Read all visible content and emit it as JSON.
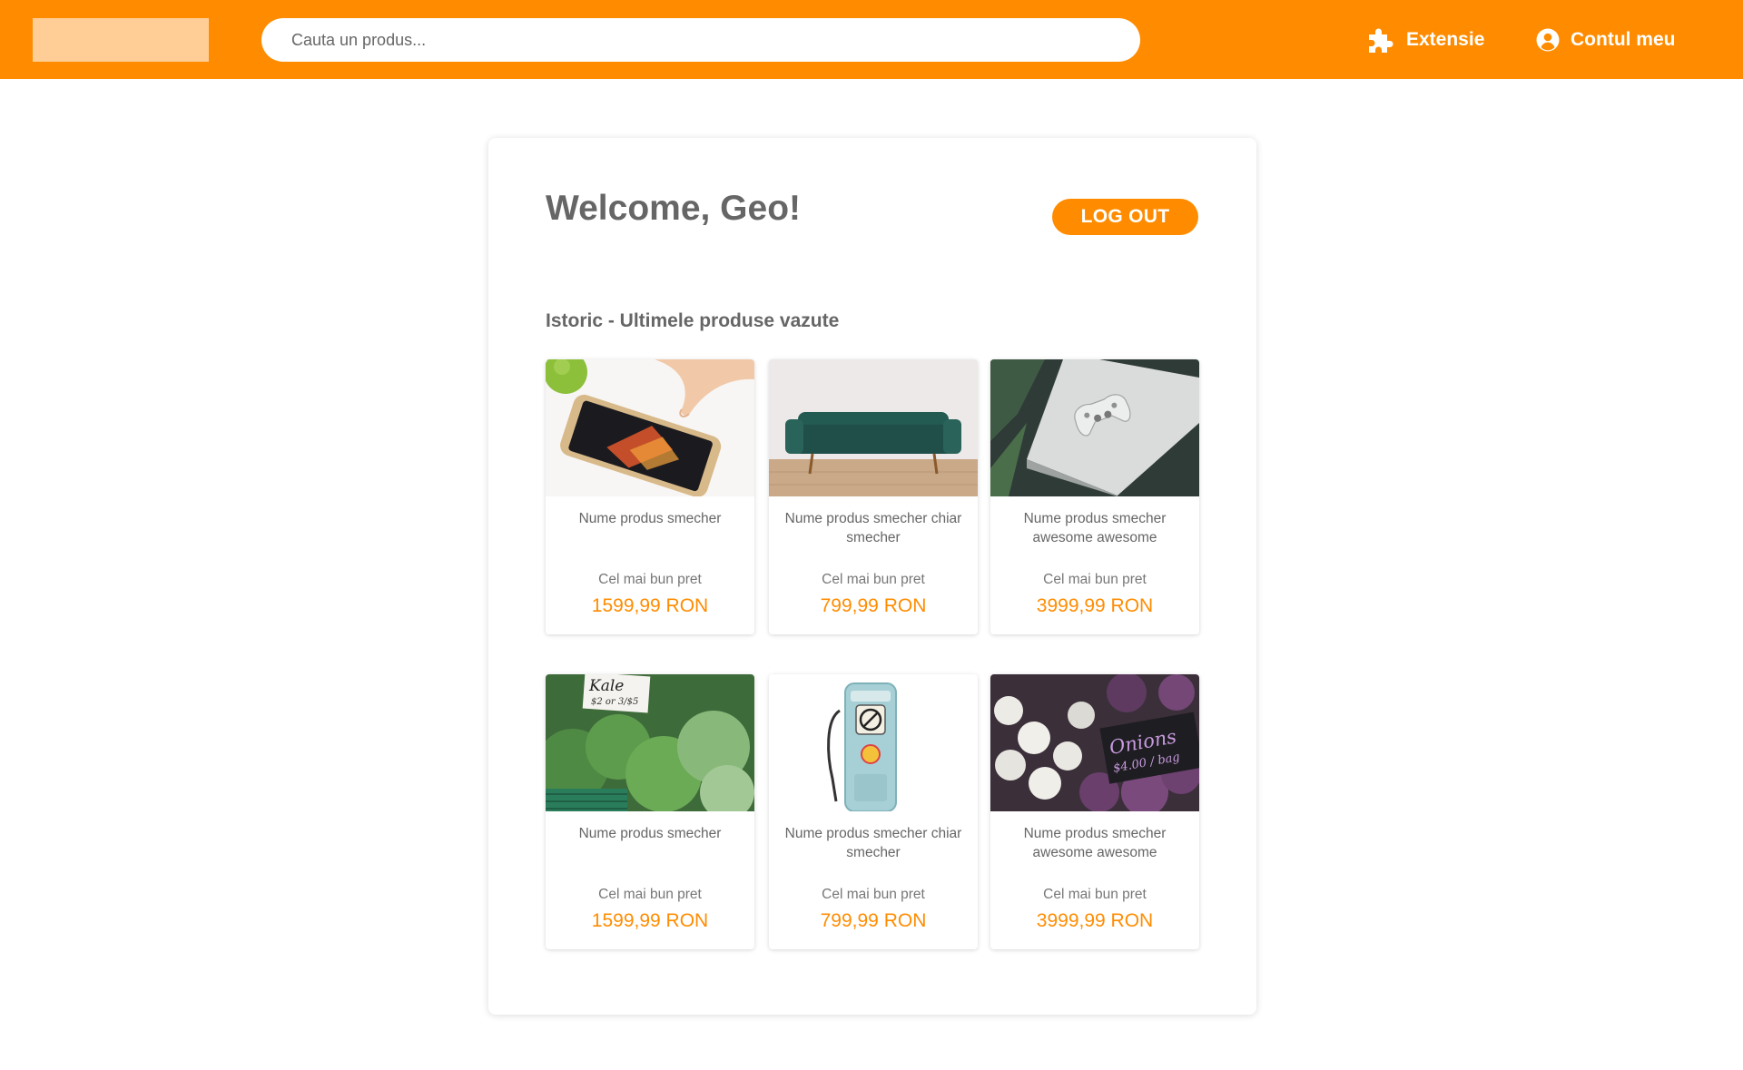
{
  "header": {
    "search_placeholder": "Cauta un produs...",
    "extension_label": "Extensie",
    "account_label": "Contul meu",
    "extension_icon": "puzzle-icon",
    "account_icon": "user-circle-icon"
  },
  "colors": {
    "accent": "#ff8c00",
    "logo_placeholder": "#ffce96",
    "text": "#666666"
  },
  "panel": {
    "welcome": "Welcome, Geo!",
    "logout_label": "LOG OUT",
    "history_title": "Istoric - Ultimele produse vazute"
  },
  "products": [
    {
      "name": "Nume produs smecher",
      "price_label": "Cel mai bun pret",
      "price": "1599,99 RON",
      "image": "smartphone"
    },
    {
      "name": "Nume produs smecher chiar smecher",
      "price_label": "Cel mai bun pret",
      "price": "799,99 RON",
      "image": "sofa"
    },
    {
      "name": "Nume produs smecher awesome awesome",
      "price_label": "Cel mai bun pret",
      "price": "3999,99 RON",
      "image": "game-console"
    },
    {
      "name": "Nume produs smecher",
      "price_label": "Cel mai bun pret",
      "price": "1599,99 RON",
      "image": "kale-market"
    },
    {
      "name": "Nume produs smecher chiar smecher",
      "price_label": "Cel mai bun pret",
      "price": "799,99 RON",
      "image": "gas-pump"
    },
    {
      "name": "Nume produs smecher awesome awesome",
      "price_label": "Cel mai bun pret",
      "price": "3999,99 RON",
      "image": "onions-market"
    }
  ],
  "image_text": {
    "kale_sign_title": "Kale",
    "kale_sign_price": "$2 or 3/$5",
    "onion_sign_title": "Onions",
    "onion_sign_price": "$4.00 / bag"
  }
}
